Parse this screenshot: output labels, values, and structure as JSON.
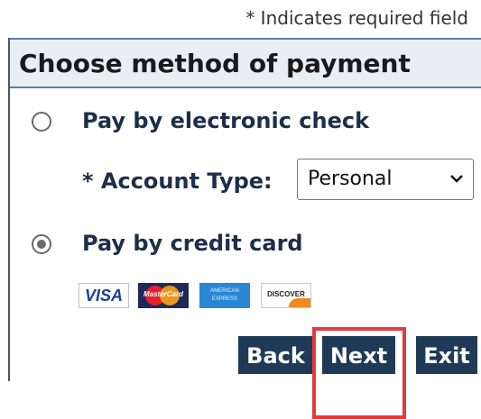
{
  "required_note": "* Indicates required field",
  "panel": {
    "title": "Choose method of payment"
  },
  "options": {
    "electronic_check": {
      "label": "Pay by electronic check",
      "selected": false
    },
    "credit_card": {
      "label": "Pay by credit card",
      "selected": true
    }
  },
  "account_type": {
    "label": "* Account Type:",
    "selected_value": "Personal"
  },
  "cards": {
    "visa": "VISA",
    "mastercard": "MasterCard",
    "amex": "AMERICAN EXPRESS",
    "discover": "DISCOVER"
  },
  "buttons": {
    "back": "Back",
    "next": "Next",
    "exit": "Exit"
  },
  "colors": {
    "button_bg": "#1f3a56",
    "highlight": "#e03c3c",
    "header_bg": "#e9eef5",
    "text": "#1c2f4a"
  }
}
